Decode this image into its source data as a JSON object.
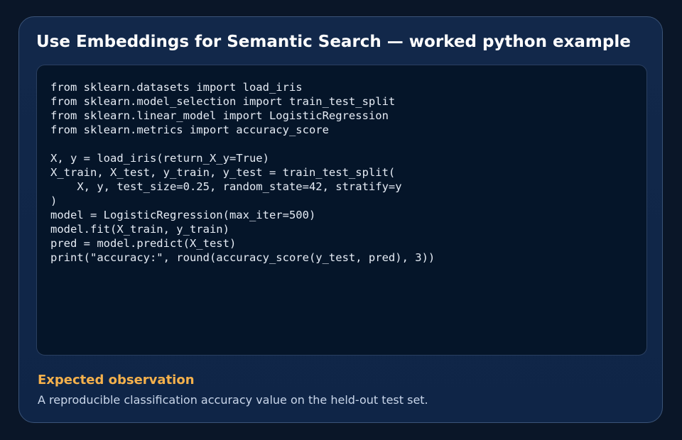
{
  "card": {
    "title": "Use Embeddings for Semantic Search — worked python example",
    "code": "from sklearn.datasets import load_iris\nfrom sklearn.model_selection import train_test_split\nfrom sklearn.linear_model import LogisticRegression\nfrom sklearn.metrics import accuracy_score\n\nX, y = load_iris(return_X_y=True)\nX_train, X_test, y_train, y_test = train_test_split(\n    X, y, test_size=0.25, random_state=42, stratify=y\n)\nmodel = LogisticRegression(max_iter=500)\nmodel.fit(X_train, y_train)\npred = model.predict(X_test)\nprint(\"accuracy:\", round(accuracy_score(y_test, pred), 3))",
    "observation_heading": "Expected observation",
    "observation_text": "A reproducible classification accuracy value on the held-out test set."
  },
  "colors": {
    "background": "#0a1628",
    "card": "#12284a",
    "code_panel": "#051529",
    "accent": "#f5b14c",
    "title": "#ffffff"
  }
}
